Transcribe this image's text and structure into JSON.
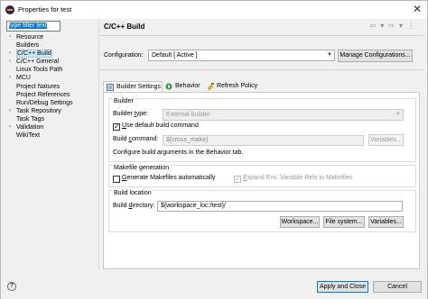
{
  "window": {
    "title": "Properties for test",
    "close_glyph": "✕"
  },
  "filter": {
    "value": "type filter text"
  },
  "tree": [
    {
      "label": "Resource",
      "arrow": "›"
    },
    {
      "label": "Builders",
      "arrow": ""
    },
    {
      "label": "C/C++ Build",
      "arrow": "›",
      "selected": true
    },
    {
      "label": "C/C++ General",
      "arrow": "›"
    },
    {
      "label": "Linux Tools Path",
      "arrow": ""
    },
    {
      "label": "MCU",
      "arrow": "›"
    },
    {
      "label": "Project Natures",
      "arrow": ""
    },
    {
      "label": "Project References",
      "arrow": ""
    },
    {
      "label": "Run/Debug Settings",
      "arrow": ""
    },
    {
      "label": "Task Repository",
      "arrow": "›"
    },
    {
      "label": "Task Tags",
      "arrow": ""
    },
    {
      "label": "Validation",
      "arrow": "›"
    },
    {
      "label": "WikiText",
      "arrow": ""
    }
  ],
  "page": {
    "title": "C/C++ Build",
    "nav": [
      "⇦",
      "▾",
      "⇨",
      "▾",
      "⋮"
    ]
  },
  "config": {
    "label": "Configuration:",
    "value": "Default  [ Active ]",
    "manage_label": "Manage Configurations..."
  },
  "tabs": [
    {
      "label": "Builder Settings",
      "icon": "builder-settings-icon"
    },
    {
      "label": "Behavior",
      "icon": "behavior-icon"
    },
    {
      "label": "Refresh Policy",
      "icon": "refresh-policy-icon"
    }
  ],
  "builder": {
    "group_title": "Builder",
    "type_label_pre": "Builder ",
    "type_label_u": "t",
    "type_label_post": "ype:",
    "type_value": "External builder",
    "use_default_u": "U",
    "use_default_post": "se default build command",
    "use_default_checked": true,
    "command_label_pre": "Build ",
    "command_label_u": "c",
    "command_label_post": "ommand:",
    "command_value": "${cross_make}",
    "variables_label": "Variables...",
    "hint": "Configure build arguments in the Behavior tab."
  },
  "makefile": {
    "group_title": "Makefile generation",
    "generate_u": "G",
    "generate_post": "enerate Makefiles automatically",
    "generate_checked": false,
    "expand_u": "E",
    "expand_post": "xpand Env. Variable Refs in Makefiles",
    "expand_checked": true
  },
  "location": {
    "group_title": "Build location",
    "dir_label_pre": "Build ",
    "dir_label_u": "d",
    "dir_label_post": "irectory:",
    "dir_value": "${workspace_loc:/test}/",
    "workspace_label": "Workspace...",
    "filesystem_label": "File system...",
    "variables_label": "Variables..."
  },
  "footer": {
    "help_glyph": "?",
    "apply_close_label": "Apply and Close",
    "cancel_label": "Cancel"
  },
  "colors": {
    "accent": "#0078d7",
    "selection_bg": "#cce8ff"
  }
}
